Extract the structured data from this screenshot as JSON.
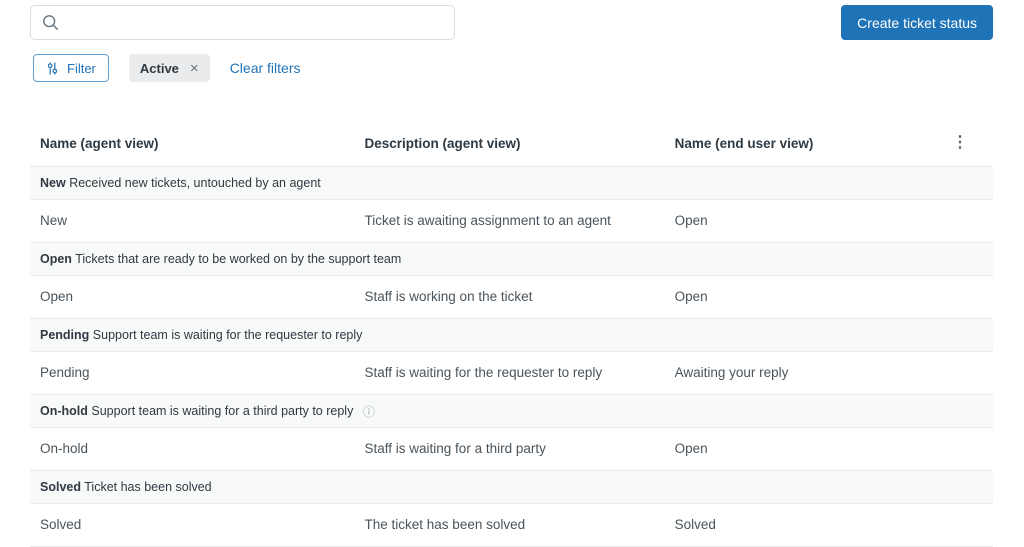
{
  "toolbar": {
    "search": {
      "value": "",
      "placeholder": ""
    },
    "create_button_label": "Create ticket status"
  },
  "filters": {
    "filter_button_label": "Filter",
    "active_chip_label": "Active",
    "clear_filters_label": "Clear filters"
  },
  "icons": {
    "kebab_menu": "⋮",
    "chip_close": "×",
    "info": "ⓘ"
  },
  "colors": {
    "accent_blue": "#1f73b7",
    "group_row_bg": "#f8f9f9",
    "border": "#e8eaec",
    "text_dark": "#2f3941",
    "text_muted": "#49545c"
  },
  "table": {
    "columns": [
      "Name (agent view)",
      "Description (agent view)",
      "Name (end user view)"
    ],
    "groups": [
      {
        "name": "New",
        "description": "Received new tickets, untouched by an agent",
        "row": {
          "agent_name": "New",
          "agent_description": "Ticket is awaiting assignment to an agent",
          "end_user_name": "Open"
        }
      },
      {
        "name": "Open",
        "description": "Tickets that are ready to be worked on by the support team",
        "row": {
          "agent_name": "Open",
          "agent_description": "Staff is working on the ticket",
          "end_user_name": "Open"
        }
      },
      {
        "name": "Pending",
        "description": "Support team is waiting for the requester to reply",
        "row": {
          "agent_name": "Pending",
          "agent_description": "Staff is waiting for the requester to reply",
          "end_user_name": "Awaiting your reply"
        }
      },
      {
        "name": "On-hold",
        "description": "Support team is waiting for a third party to reply",
        "has_info_icon": true,
        "row": {
          "agent_name": "On-hold",
          "agent_description": "Staff is waiting for a third party",
          "end_user_name": "Open"
        }
      },
      {
        "name": "Solved",
        "description": "Ticket has been solved",
        "row": {
          "agent_name": "Solved",
          "agent_description": "The ticket has been solved",
          "end_user_name": "Solved"
        }
      }
    ]
  }
}
